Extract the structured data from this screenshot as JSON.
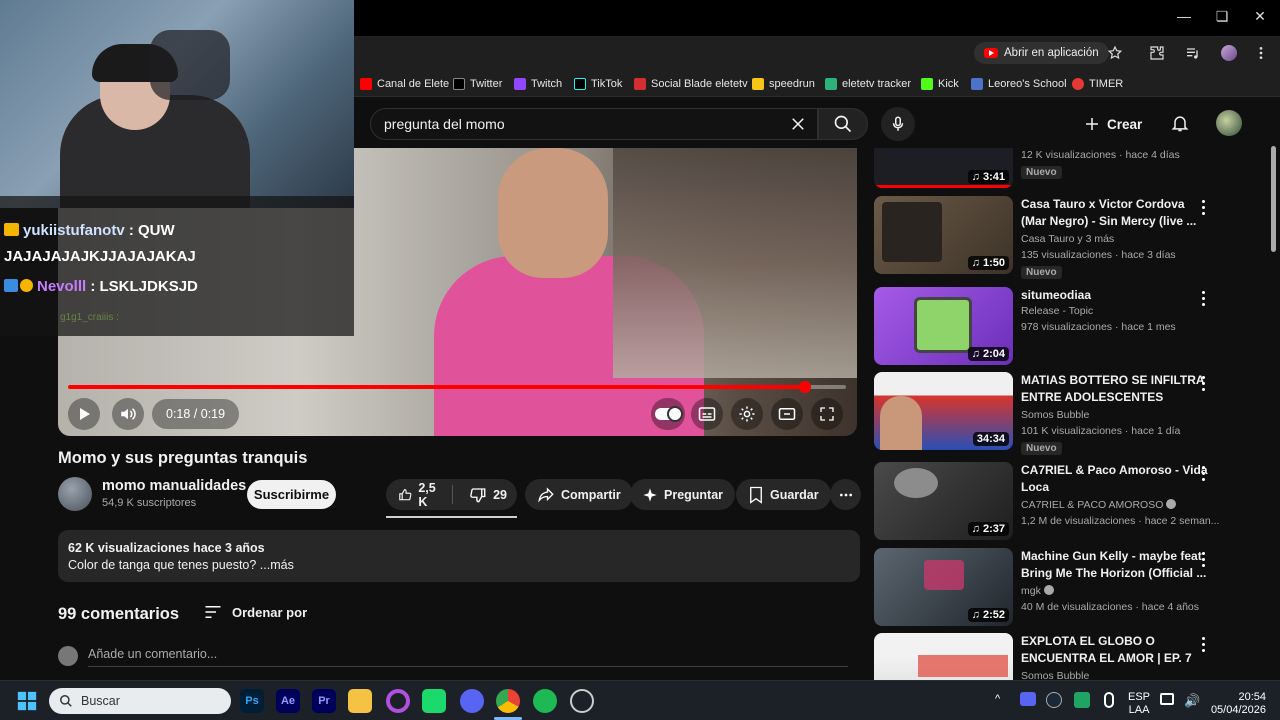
{
  "browser": {
    "open_in_app_label": "Abrir en aplicación",
    "bookmarks": [
      {
        "label": "Canal de Elete",
        "color": "#ff0000"
      },
      {
        "label": "Twitter",
        "color": "#000000"
      },
      {
        "label": "Twitch",
        "color": "#9146ff"
      },
      {
        "label": "TikTok",
        "color": "#010101"
      },
      {
        "label": "Social Blade eletetv",
        "color": "#d32f2f"
      },
      {
        "label": "speedrun",
        "color": "#f5c518"
      },
      {
        "label": "eletetv tracker",
        "color": "#2bb37b"
      },
      {
        "label": "Kick",
        "color": "#53fc18"
      },
      {
        "label": "Leoreo's School",
        "color": "#4a73c9"
      },
      {
        "label": "TIMER",
        "color": "#e53935"
      }
    ]
  },
  "stream_overlay": {
    "chat": [
      {
        "user": "yukiistufanotv",
        "user_color": "#cfe3ff",
        "message": " : QUW"
      },
      {
        "user": "",
        "user_color": "#ffffff",
        "message": "JAJAJAJAJKJJAJAJAKAJ"
      },
      {
        "user": "Nevolll",
        "user_color": "#c57cff",
        "message": " : LSKLJDKSJD"
      }
    ],
    "faded_user": "g1g1_craiiis :"
  },
  "youtube": {
    "search_query": "pregunta del momo",
    "create_label": "Crear",
    "player": {
      "time": "0:18 / 0:19",
      "progress": 0.947
    },
    "video": {
      "title": "Momo y sus preguntas tranquis",
      "channel": "momo manualidades",
      "subscribers": "54,9 K suscriptores",
      "subscribe_label": "Suscribirme",
      "likes": "2,5 K",
      "dislikes": "29",
      "share_label": "Compartir",
      "ask_label": "Preguntar",
      "save_label": "Guardar",
      "views_date": "62 K visualizaciones  hace 3 años",
      "description": "Color de tanga que tenes puesto? ...más"
    },
    "comments": {
      "count": "99 comentarios",
      "sort_label": "Ordenar por",
      "placeholder": "Añade un comentario..."
    },
    "recommendations": [
      {
        "title": "",
        "channel": "",
        "meta": "12 K visualizaciones · hace 4 días",
        "badge": "Nuevo",
        "duration": "3:41",
        "thumb_color": "#1d1d24"
      },
      {
        "title": "Casa Tauro x Victor Cordova (Mar Negro) - Sin Mercy (live ...",
        "channel": "Casa Tauro y 3 más",
        "meta": "135 visualizaciones · hace 3 días",
        "badge": "Nuevo",
        "duration": "1:50",
        "thumb_color": "#5a4a3a"
      },
      {
        "title": "situmeodiaa",
        "channel": "Release - Topic",
        "meta": "978 visualizaciones · hace 1 mes",
        "badge": "",
        "duration": "2:04",
        "thumb_color": "#8e3fd6"
      },
      {
        "title": "MATIAS BOTTERO SE INFILTRA ENTRE ADOLESCENTES",
        "channel": "Somos Bubble",
        "meta": "101 K visualizaciones · hace 1 día",
        "badge": "Nuevo",
        "duration": "34:34",
        "thumb_color": "#d9342b"
      },
      {
        "title": "CA7RIEL & Paco Amoroso - Vida Loca",
        "channel": "CA7RIEL & PACO AMOROSO",
        "meta": "1,2 M de visualizaciones · hace 2 seman...",
        "badge": "",
        "duration": "2:37",
        "thumb_color": "#3b3b3b"
      },
      {
        "title": "Machine Gun Kelly - maybe feat. Bring Me The Horizon (Official ...",
        "channel": "mgk",
        "meta": "40 M de visualizaciones · hace 4 años",
        "badge": "",
        "duration": "2:52",
        "thumb_color": "#2e3640"
      },
      {
        "title": "EXPLOTA EL GLOBO O ENCUENTRA EL AMOR  |  EP. 7",
        "channel": "Somos Bubble",
        "meta": "",
        "badge": "",
        "duration": "",
        "thumb_color": "#e8e8e8"
      }
    ]
  },
  "taskbar": {
    "search_placeholder": "Buscar",
    "language": "ESP",
    "region": "LAA",
    "time": "20:54",
    "date": "05/04/2026"
  }
}
